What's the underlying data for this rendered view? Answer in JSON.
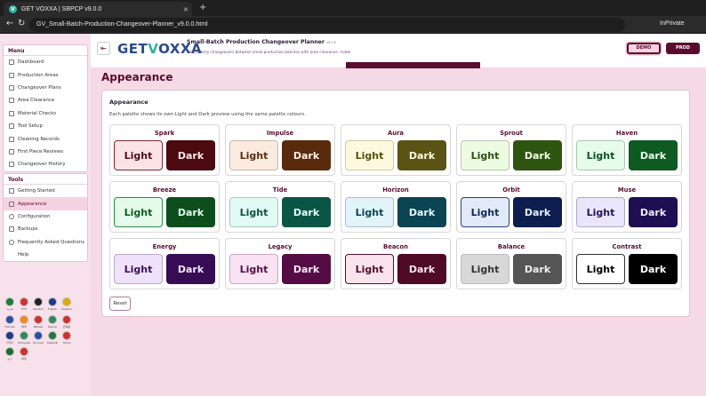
{
  "browser": {
    "tab_title": "GET VOXXA | SBPCP v9.0.0",
    "tab_icon": "V",
    "close_glyph": "×",
    "new_tab_glyph": "+",
    "back_glyph": "←",
    "reload_glyph": "↻",
    "url": "GV_Small-Batch-Production-Changeover-Planner_v9.0.0.html",
    "mode": "InPrivate"
  },
  "header": {
    "collapse_glyph": "⇤",
    "logo_get": "GET",
    "logo_v": "V",
    "logo_rest": "OXXA",
    "app_title": "Small-Batch Production Changeover Planner",
    "app_version": "v9.0.0",
    "app_subtitle": "Plan orderly changeovers between small production batches with area clearance, material ch",
    "demo_label": "DEMO",
    "prod_label": "PROD"
  },
  "sidebar": {
    "menu_heading": "Menu",
    "menu_items": [
      {
        "label": "Dashboard",
        "icon": "dashboard-icon"
      },
      {
        "label": "Production Areas",
        "icon": "areas-icon"
      },
      {
        "label": "Changeover Plans",
        "icon": "plans-icon"
      },
      {
        "label": "Area Clearance",
        "icon": "clearance-icon"
      },
      {
        "label": "Material Checks",
        "icon": "material-icon"
      },
      {
        "label": "Tool Setup",
        "icon": "tool-icon"
      },
      {
        "label": "Cleaning Records",
        "icon": "cleaning-icon"
      },
      {
        "label": "First Piece Reviews",
        "icon": "review-icon"
      },
      {
        "label": "Changeover History",
        "icon": "history-icon"
      }
    ],
    "tools_heading": "Tools",
    "tools_items": [
      {
        "label": "Getting Started",
        "icon": "start-icon"
      },
      {
        "label": "Appearance",
        "icon": "appearance-icon",
        "active": true
      },
      {
        "label": "Configuration",
        "icon": "gear-icon"
      },
      {
        "label": "Backups",
        "icon": "backup-icon"
      },
      {
        "label": "Frequently Asked Questions",
        "icon": "faq-icon"
      },
      {
        "label": "Help",
        "icon": ""
      }
    ],
    "flags": [
      {
        "label": "العربية",
        "color": "#1f7a3c"
      },
      {
        "label": "বাংলা",
        "color": "#d32f2f"
      },
      {
        "label": "Deutsch",
        "color": "#222222"
      },
      {
        "label": "English",
        "color": "#1f3a8a"
      },
      {
        "label": "Español",
        "color": "#e0a800"
      },
      {
        "label": "",
        "color": "#ffffff"
      },
      {
        "label": "Français",
        "color": "#2a4fa8"
      },
      {
        "label": "हिन्दी",
        "color": "#f08a1c"
      },
      {
        "label": "Bahasa",
        "color": "#d32f2f"
      },
      {
        "label": "Italiano",
        "color": "#2e8b57"
      },
      {
        "label": "日本語",
        "color": "#d32f2f"
      },
      {
        "label": "",
        "color": "#ffffff"
      },
      {
        "label": "한국어",
        "color": "#1f3a8a"
      },
      {
        "label": "Português",
        "color": "#2e8b57"
      },
      {
        "label": "Русский",
        "color": "#2a4fa8"
      },
      {
        "label": "Kiswahili",
        "color": "#1f7a3c"
      },
      {
        "label": "Türkçe",
        "color": "#d32f2f"
      },
      {
        "label": "",
        "color": "#ffffff"
      },
      {
        "label": "اردو",
        "color": "#1f6b35"
      },
      {
        "label": "中文",
        "color": "#d32f2f"
      }
    ]
  },
  "main": {
    "page_title": "Appearance",
    "card_title": "Appearance",
    "card_description": "Each palette shows its own Light and Dark preview using the same palette colours.",
    "light_label": "Light",
    "dark_label": "Dark",
    "reset_label": "Reset",
    "palettes": [
      {
        "name": "Spark",
        "light_bg": "#fbe3e6",
        "light_fg": "#4f0f17",
        "light_border": "#7a2a32",
        "dark_bg": "#4a0a10",
        "dark_fg": "#ffe8ea"
      },
      {
        "name": "Impulse",
        "light_bg": "#fbeadf",
        "light_fg": "#5a2e10",
        "light_border": "#c8b7a8",
        "dark_bg": "#5a2a0c",
        "dark_fg": "#fff0e4"
      },
      {
        "name": "Aura",
        "light_bg": "#fdf9de",
        "light_fg": "#55510f",
        "light_border": "#cfcaa0",
        "dark_bg": "#5a5414",
        "dark_fg": "#fffbe0"
      },
      {
        "name": "Sprout",
        "light_bg": "#eefbe3",
        "light_fg": "#2d5010",
        "light_border": "#b8c8a8",
        "dark_bg": "#2e5510",
        "dark_fg": "#f0ffe4"
      },
      {
        "name": "Haven",
        "light_bg": "#e6fbe9",
        "light_fg": "#0e5320",
        "light_border": "#a8c8ae",
        "dark_bg": "#0d5a22",
        "dark_fg": "#e8ffec"
      },
      {
        "name": "Breeze",
        "light_bg": "#e3fbe8",
        "light_fg": "#0f5a24",
        "light_border": "#2e8a44",
        "dark_bg": "#0c4f1d",
        "dark_fg": "#e6ffec"
      },
      {
        "name": "Tide",
        "light_bg": "#e1faf3",
        "light_fg": "#0b5445",
        "light_border": "#a8c8c0",
        "dark_bg": "#0b5545",
        "dark_fg": "#e4fff8"
      },
      {
        "name": "Horizon",
        "light_bg": "#e0f4fa",
        "light_fg": "#0b4656",
        "light_border": "#a8c0c8",
        "dark_bg": "#0b4452",
        "dark_fg": "#e4f8ff"
      },
      {
        "name": "Orbit",
        "light_bg": "#e2eaf8",
        "light_fg": "#10285a",
        "light_border": "#2a3f7a",
        "dark_bg": "#0c1e4f",
        "dark_fg": "#e6eeff"
      },
      {
        "name": "Muse",
        "light_bg": "#e9e6fb",
        "light_fg": "#241456",
        "light_border": "#b0a8c8",
        "dark_bg": "#1e0e52",
        "dark_fg": "#eeeaff"
      },
      {
        "name": "Energy",
        "light_bg": "#efe1f9",
        "light_fg": "#3a0f5a",
        "light_border": "#bca8c8",
        "dark_bg": "#360c55",
        "dark_fg": "#f4e8ff"
      },
      {
        "name": "Legacy",
        "light_bg": "#f8e2f3",
        "light_fg": "#560f47",
        "light_border": "#c8a8c0",
        "dark_bg": "#550c45",
        "dark_fg": "#ffe8f8"
      },
      {
        "name": "Beacon",
        "light_bg": "#f9e3ec",
        "light_fg": "#4f0d27",
        "light_border": "#5a0d2e",
        "dark_bg": "#4f0a25",
        "dark_fg": "#ffe8f0"
      },
      {
        "name": "Balance",
        "light_bg": "#d8d8d8",
        "light_fg": "#333333",
        "light_border": "#bbbbbb",
        "dark_bg": "#555555",
        "dark_fg": "#eeeeee"
      },
      {
        "name": "Contrast",
        "light_bg": "#ffffff",
        "light_fg": "#000000",
        "light_border": "#333333",
        "dark_bg": "#000000",
        "dark_fg": "#ffffff"
      }
    ]
  },
  "colors": {
    "accent": "#5a0d2e",
    "page_bg": "#f5d9e5",
    "active_nav_bg": "#f5d3e1"
  }
}
